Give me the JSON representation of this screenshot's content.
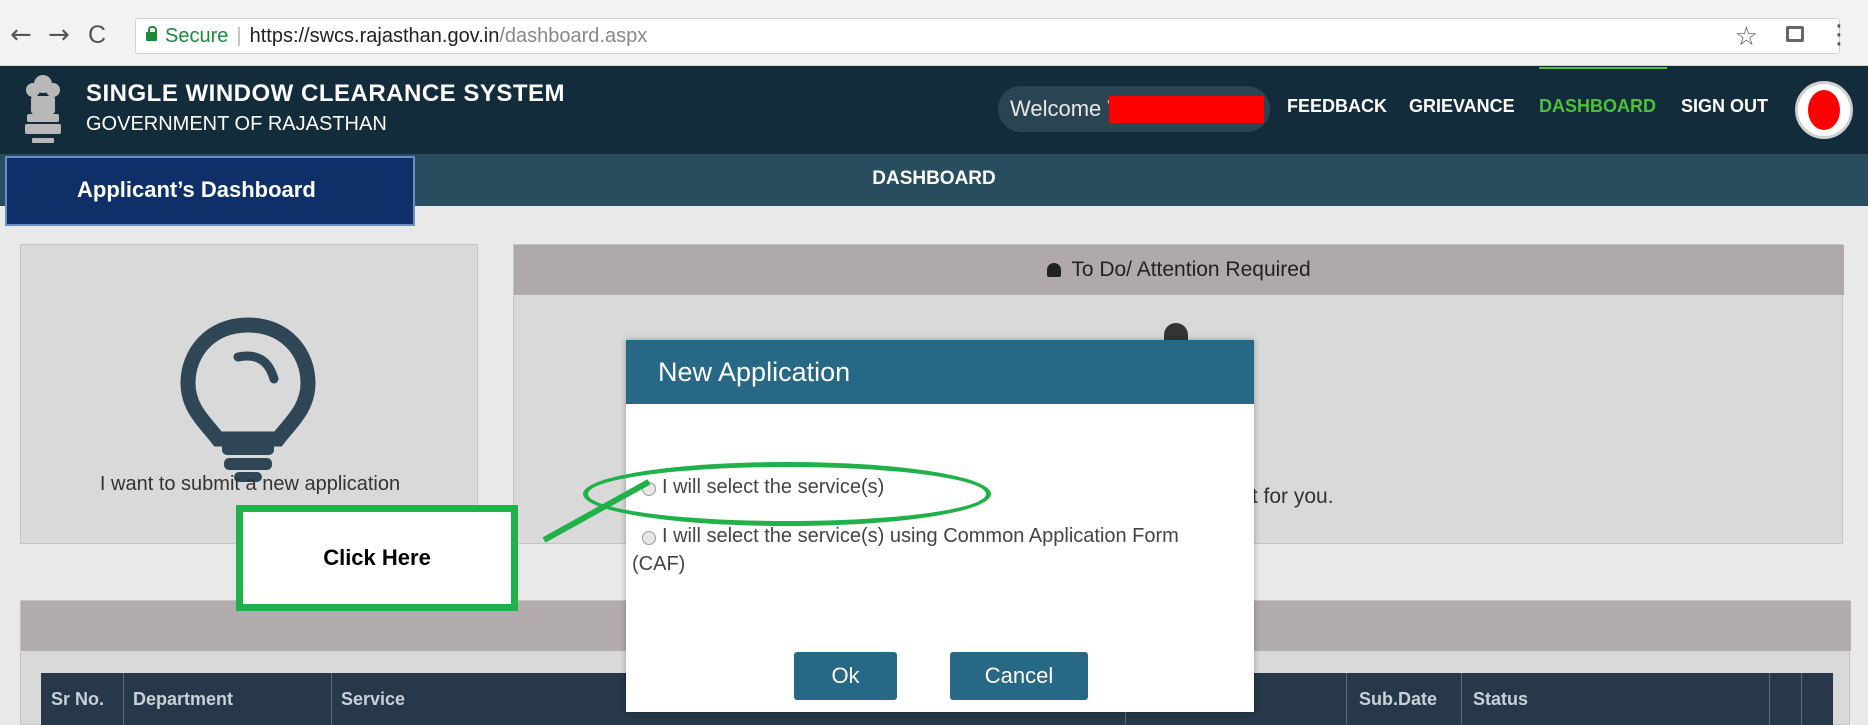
{
  "browser": {
    "nav": {
      "back": "←",
      "forward": "→",
      "reload": "C"
    },
    "secure_label": "Secure",
    "separator": "|",
    "url_host": "https://swcs.rajasthan.gov.in",
    "url_path": "/dashboard.aspx",
    "star": "☆",
    "menu": "⋮"
  },
  "header": {
    "title": "SINGLE WINDOW CLEARANCE SYSTEM",
    "subtitle": "GOVERNMENT OF RAJASTHAN",
    "welcome": "Welcome V",
    "nav": [
      {
        "label": "FEEDBACK",
        "active": false
      },
      {
        "label": "GRIEVANCE",
        "active": false
      },
      {
        "label": "DASHBOARD",
        "active": true
      },
      {
        "label": "SIGN OUT",
        "active": false
      }
    ]
  },
  "subbar": {
    "title": "DASHBOARD",
    "applicant_label": "Applicant’s Dashboard"
  },
  "cards": {
    "new_app_text": "I want to submit a new application",
    "todo_title": "To Do/ Attention Required",
    "todo_text_fragment": "list for you."
  },
  "table": {
    "headers": [
      "Sr No.",
      "Department",
      "Service",
      "Sub.Date",
      "Status"
    ]
  },
  "modal": {
    "title": "New Application",
    "option1": "I will select the service(s)",
    "option2_line1": "I will select the service(s) using Common Application Form",
    "option2_line2": "(CAF)",
    "ok": "Ok",
    "cancel": "Cancel"
  },
  "annotation": {
    "label": "Click Here",
    "color": "#21b14b"
  },
  "colors": {
    "header_bg": "#132c3b",
    "subbar_bg": "#284d5e",
    "modal_accent": "#276887",
    "active_nav": "#4cc23a",
    "redaction": "#ff0000"
  }
}
